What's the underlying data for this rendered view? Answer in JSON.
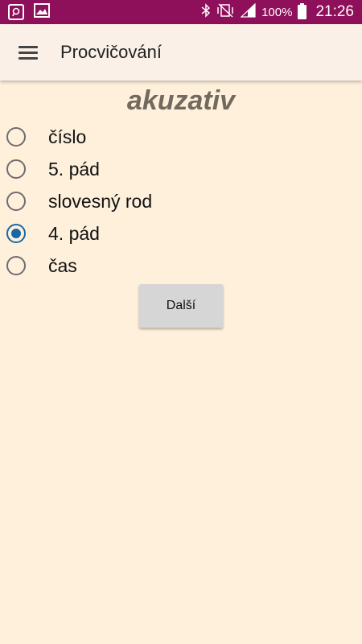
{
  "status_bar": {
    "battery": "100%",
    "time": "21:26",
    "icons": [
      "notification-app-icon",
      "image-icon",
      "bluetooth-icon",
      "vibrate-icon",
      "signal-icon",
      "battery-icon"
    ],
    "color": "#8e0f5a"
  },
  "app_bar": {
    "title": "Procvičování",
    "menu_icon": "hamburger-menu-icon"
  },
  "quiz": {
    "question": "akuzativ",
    "options": [
      {
        "label": "číslo",
        "checked": false
      },
      {
        "label": "5. pád",
        "checked": false
      },
      {
        "label": "slovesný rod",
        "checked": false
      },
      {
        "label": "4. pád",
        "checked": true
      },
      {
        "label": "čas",
        "checked": false
      }
    ],
    "next_label": "Další"
  },
  "colors": {
    "background": "#fff0dc",
    "accent": "#1a67a3"
  }
}
